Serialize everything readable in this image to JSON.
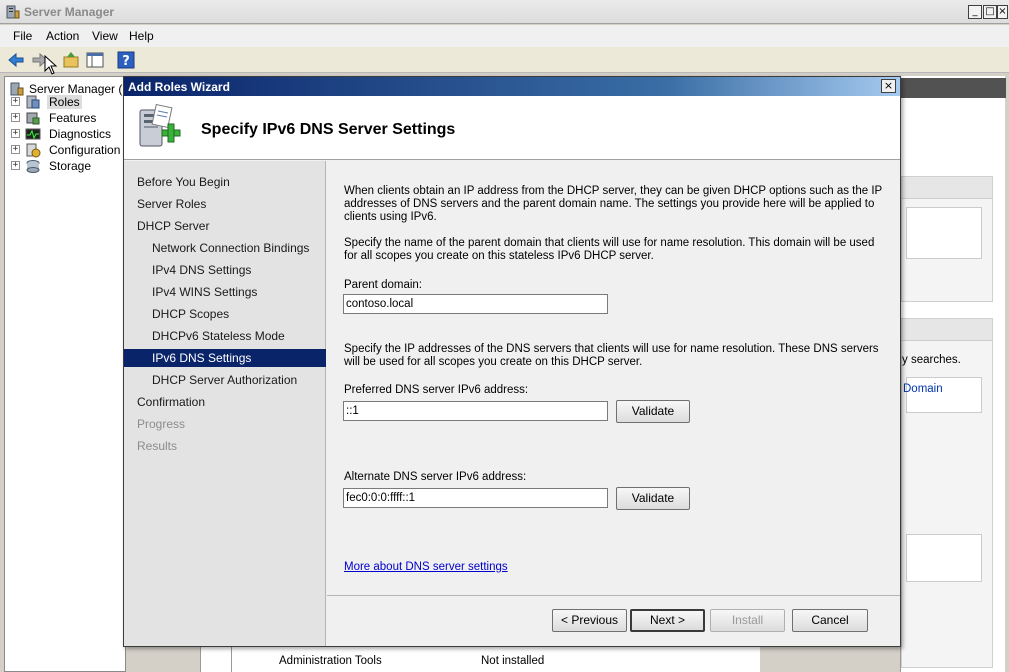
{
  "window": {
    "title": "Server Manager",
    "buttons": [
      "_",
      "□",
      "×"
    ]
  },
  "menu": {
    "items": [
      "File",
      "Action",
      "View",
      "Help"
    ]
  },
  "tree": {
    "root": "Server Manager (SE",
    "items": [
      "Roles",
      "Features",
      "Diagnostics",
      "Configuration",
      "Storage"
    ]
  },
  "background": {
    "right_snippet_1": "y searches.",
    "right_snippet_2": "Domain",
    "bottom_left": "Administration Tools",
    "bottom_right": "Not installed"
  },
  "wizard": {
    "title": "Add Roles Wizard",
    "close_glyph": "×",
    "heading": "Specify IPv6 DNS Server Settings",
    "nav": [
      {
        "label": "Before You Begin",
        "level": 1,
        "state": "normal"
      },
      {
        "label": "Server Roles",
        "level": 1,
        "state": "normal"
      },
      {
        "label": "DHCP Server",
        "level": 1,
        "state": "normal"
      },
      {
        "label": "Network Connection Bindings",
        "level": 2,
        "state": "normal"
      },
      {
        "label": "IPv4 DNS Settings",
        "level": 2,
        "state": "normal"
      },
      {
        "label": "IPv4 WINS Settings",
        "level": 2,
        "state": "normal"
      },
      {
        "label": "DHCP Scopes",
        "level": 2,
        "state": "normal"
      },
      {
        "label": "DHCPv6 Stateless Mode",
        "level": 2,
        "state": "normal"
      },
      {
        "label": "IPv6 DNS Settings",
        "level": 2,
        "state": "active"
      },
      {
        "label": "DHCP Server Authorization",
        "level": 2,
        "state": "normal"
      },
      {
        "label": "Confirmation",
        "level": 1,
        "state": "normal"
      },
      {
        "label": "Progress",
        "level": 1,
        "state": "disabled"
      },
      {
        "label": "Results",
        "level": 1,
        "state": "disabled"
      }
    ],
    "content": {
      "intro": "When clients obtain an IP address from the DHCP server, they can be given DHCP options such as the IP addresses of DNS servers and the parent domain name. The settings you provide here will be applied to clients using IPv6.",
      "domain_help": "Specify the name of the parent domain that clients will use for name resolution. This domain will be used for all scopes you create on this stateless IPv6 DHCP server.",
      "parent_domain_label": "Parent domain:",
      "parent_domain_value": "contoso.local",
      "dns_help": "Specify the IP addresses of the DNS servers that clients will use for name resolution. These DNS servers will be used for all scopes you create on this DHCP server.",
      "preferred_label": "Preferred DNS server IPv6 address:",
      "preferred_value": "::1",
      "alternate_label": "Alternate DNS server IPv6 address:",
      "alternate_value": "fec0:0:0:ffff::1",
      "validate_label": "Validate",
      "more_link": "More about DNS server settings"
    },
    "footer": {
      "previous": "< Previous",
      "next": "Next >",
      "install": "Install",
      "cancel": "Cancel"
    }
  },
  "colors": {
    "wizard_title_start": "#0a246a",
    "active_nav": "#0a246a",
    "link": "#0000cc"
  }
}
